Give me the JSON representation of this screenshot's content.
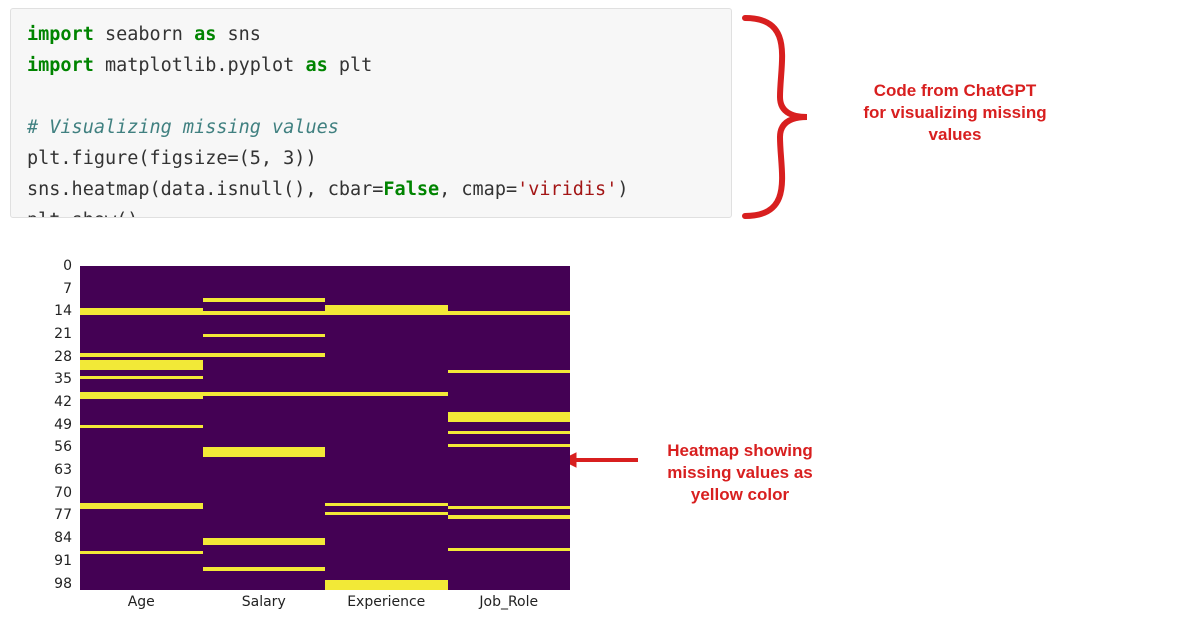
{
  "code": {
    "line1_kw1": "import",
    "line1_rest": " seaborn ",
    "line1_kw2": "as",
    "line1_rest2": " sns",
    "line2_kw1": "import",
    "line2_rest": " matplotlib.pyplot ",
    "line2_kw2": "as",
    "line2_rest2": " plt",
    "line3": "",
    "line4_comment": "# Visualizing missing values",
    "line5": "plt.figure(figsize=(5, 3))",
    "line6_a": "sns.heatmap(data.isnull(), cbar=",
    "line6_false": "False",
    "line6_b": ", cmap=",
    "line6_str": "'viridis'",
    "line6_c": ")",
    "line7": "plt.show()"
  },
  "annotations": {
    "a1_l1": "Code from ChatGPT",
    "a1_l2": "for visualizing missing",
    "a1_l3": "values",
    "a2_l1": "Heatmap showing",
    "a2_l2": "missing values as",
    "a2_l3": "yellow color"
  },
  "chart_data": {
    "type": "heatmap",
    "title": "",
    "xlabel": "",
    "ylabel": "",
    "x_categories": [
      "Age",
      "Salary",
      "Experience",
      "Job_Role"
    ],
    "y_ticks": [
      0,
      7,
      14,
      21,
      28,
      35,
      42,
      49,
      56,
      63,
      70,
      77,
      84,
      91,
      98
    ],
    "nrows": 100,
    "cmap": "viridis",
    "legend": "yellow = missing (null), dark purple = present",
    "missing_rows_by_column": {
      "Age": [
        13,
        14,
        27,
        29,
        30,
        31,
        34,
        39,
        40,
        49,
        73,
        74,
        88
      ],
      "Salary": [
        10,
        14,
        21,
        27,
        39,
        56,
        57,
        58,
        84,
        85,
        93
      ],
      "Experience": [
        12,
        13,
        14,
        39,
        73,
        76,
        97,
        98,
        99
      ],
      "Job_Role": [
        14,
        32,
        45,
        46,
        47,
        51,
        55,
        74,
        77,
        87
      ]
    }
  }
}
